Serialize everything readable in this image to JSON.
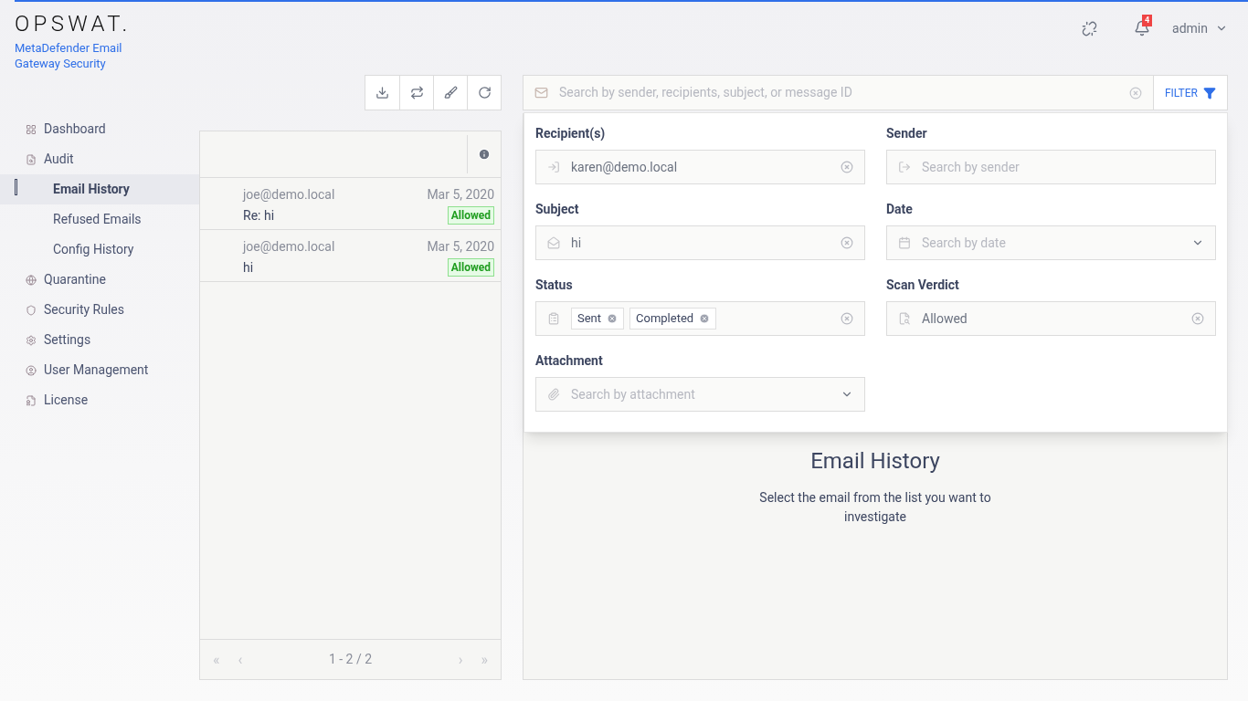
{
  "brand": {
    "logo": "OPSWAT.",
    "product": "MetaDefender Email Gateway Security"
  },
  "header": {
    "notifications": "4",
    "user": "admin"
  },
  "sidebar": {
    "items": [
      {
        "label": "Dashboard",
        "selected": false
      },
      {
        "label": "Audit",
        "selected": false,
        "children": [
          {
            "label": "Email History",
            "selected": true
          },
          {
            "label": "Refused Emails",
            "selected": false
          },
          {
            "label": "Config History",
            "selected": false
          }
        ]
      },
      {
        "label": "Quarantine",
        "selected": false
      },
      {
        "label": "Security Rules",
        "selected": false
      },
      {
        "label": "Settings",
        "selected": false
      },
      {
        "label": "User Management",
        "selected": false
      },
      {
        "label": "License",
        "selected": false
      }
    ]
  },
  "email_list": {
    "rows": [
      {
        "sender": "joe@demo.local",
        "subject": "Re: hi",
        "date": "Mar 5, 2020",
        "verdict": "Allowed"
      },
      {
        "sender": "joe@demo.local",
        "subject": "hi",
        "date": "Mar 5, 2020",
        "verdict": "Allowed"
      }
    ],
    "pagination": {
      "first": "«",
      "prev": "‹",
      "range": "1 - 2 / 2",
      "next": "›",
      "last": "»"
    }
  },
  "search": {
    "placeholder": "Search by sender, recipients, subject, or message ID",
    "filter_button": "FILTER"
  },
  "filters": [
    {
      "label": "Recipient(s)",
      "kind": "text",
      "value": "karen@demo.local"
    },
    {
      "label": "Sender",
      "kind": "text",
      "placeholder": "Search by sender"
    },
    {
      "label": "Subject",
      "kind": "text",
      "value": "hi"
    },
    {
      "label": "Date",
      "kind": "select",
      "placeholder": "Search by date"
    },
    {
      "label": "Status",
      "kind": "tags",
      "tags": [
        "Sent",
        "Completed"
      ]
    },
    {
      "label": "Scan Verdict",
      "kind": "text",
      "value": "Allowed"
    },
    {
      "label": "Attachment",
      "kind": "select",
      "placeholder": "Search by attachment"
    }
  ],
  "details": {
    "title": "Email History",
    "message": "Select the email from the list you want to investigate"
  }
}
